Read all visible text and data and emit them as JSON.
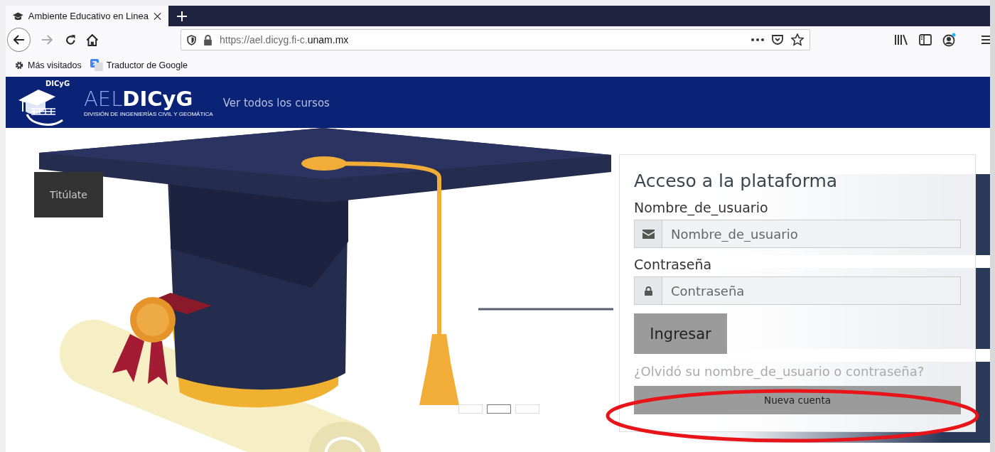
{
  "browser": {
    "tab": {
      "title": "Ambiente Educativo en Linea"
    },
    "url": {
      "prefix": "https://ael.dicyg.fi-c.",
      "domain": "unam.mx"
    },
    "bookmarks": [
      {
        "label": "Más visitados",
        "kind": "folder"
      },
      {
        "label": "Traductor de Google",
        "kind": "translate"
      }
    ]
  },
  "header": {
    "logo_badge": "DICyG",
    "brand_light": "AEL",
    "brand_bold": "DICyG",
    "brand_subtitle": "DIVISIÓN DE INGENIERÍAS CIVIL Y GEOMÁTICA",
    "nav_link": "Ver todos los cursos"
  },
  "slider": {
    "caption": "Titúlate",
    "indicators": [
      {
        "selected": false
      },
      {
        "selected": true
      },
      {
        "selected": false
      }
    ]
  },
  "login": {
    "title": "Acceso a la plataforma",
    "username_label": "Nombre_de_usuario",
    "username_placeholder": "Nombre_de_usuario",
    "password_label": "Contraseña",
    "password_placeholder": "Contraseña",
    "submit": "Ingresar",
    "forgot_link": "¿Olvidó su nombre_de_usuario o contraseña?",
    "signup": "Nueva cuenta"
  }
}
